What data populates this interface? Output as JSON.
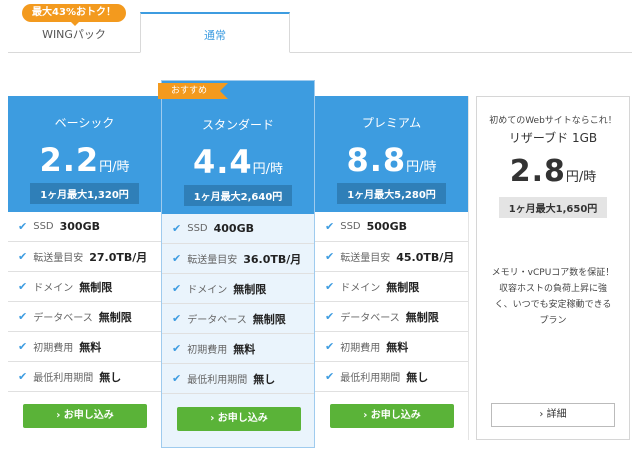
{
  "tabs": {
    "badge": "最大43%おトク！",
    "wing_label": "WINGパック",
    "normal_label": "通常"
  },
  "recommend_label": "おすすめ",
  "plans": [
    {
      "name": "ベーシック",
      "price": "2.2",
      "unit": "円/時",
      "monthly": "1ヶ月最大1,320円",
      "features": [
        {
          "label": "SSD",
          "value": "300GB"
        },
        {
          "label": "転送量目安",
          "value": "27.0TB/月"
        },
        {
          "label": "ドメイン",
          "value": "無制限"
        },
        {
          "label": "データベース",
          "value": "無制限"
        },
        {
          "label": "初期費用",
          "value": "無料"
        },
        {
          "label": "最低利用期間",
          "value": "無し"
        }
      ],
      "button": "› お申し込み"
    },
    {
      "name": "スタンダード",
      "price": "4.4",
      "unit": "円/時",
      "monthly": "1ヶ月最大2,640円",
      "features": [
        {
          "label": "SSD",
          "value": "400GB"
        },
        {
          "label": "転送量目安",
          "value": "36.0TB/月"
        },
        {
          "label": "ドメイン",
          "value": "無制限"
        },
        {
          "label": "データベース",
          "value": "無制限"
        },
        {
          "label": "初期費用",
          "value": "無料"
        },
        {
          "label": "最低利用期間",
          "value": "無し"
        }
      ],
      "button": "› お申し込み"
    },
    {
      "name": "プレミアム",
      "price": "8.8",
      "unit": "円/時",
      "monthly": "1ヶ月最大5,280円",
      "features": [
        {
          "label": "SSD",
          "value": "500GB"
        },
        {
          "label": "転送量目安",
          "value": "45.0TB/月"
        },
        {
          "label": "ドメイン",
          "value": "無制限"
        },
        {
          "label": "データベース",
          "value": "無制限"
        },
        {
          "label": "初期費用",
          "value": "無料"
        },
        {
          "label": "最低利用期間",
          "value": "無し"
        }
      ],
      "button": "› お申し込み"
    }
  ],
  "reserve": {
    "subtitle": "初めてのWebサイトならこれ！",
    "name": "リザーブド 1GB",
    "price": "2.8",
    "unit": "円/時",
    "monthly": "1ヶ月最大1,650円",
    "description": "メモリ・vCPUコア数を保証！収容ホストの負荷上昇に強く、いつでも安定稼動できるプラン",
    "button": "› 詳細"
  },
  "colors": {
    "accent_blue": "#3d9ce0",
    "badge_orange": "#f39a1e",
    "apply_green": "#5ab338"
  },
  "icons": {
    "feature_check": "check-icon"
  }
}
